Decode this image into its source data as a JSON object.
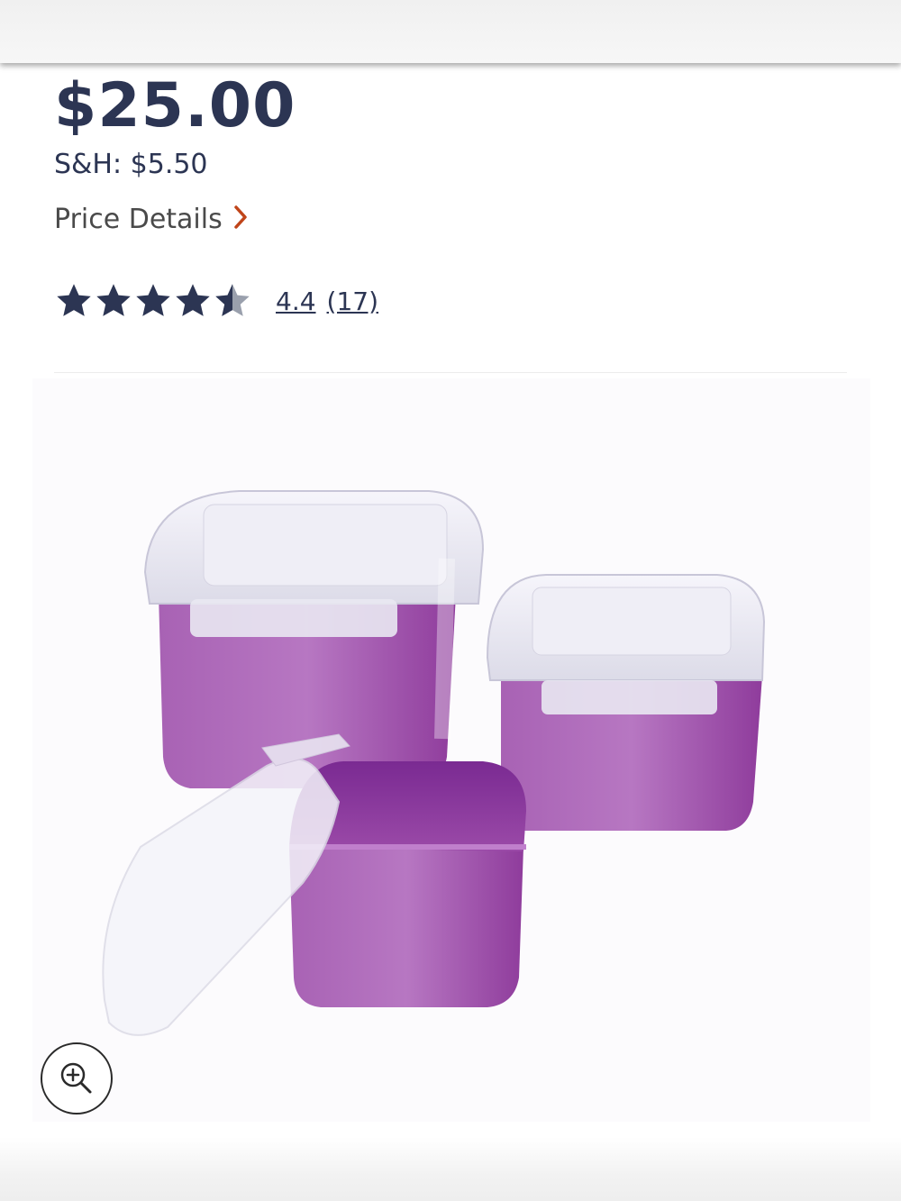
{
  "product": {
    "price": "$25.00",
    "shipping": "S&H: $5.50",
    "price_details_label": "Price Details",
    "rating": {
      "value": "4.4",
      "count": "(17)",
      "stars_fraction": 0.88
    },
    "image": {
      "subject": "purple food storage containers"
    }
  },
  "colors": {
    "price_text": "#2c3553",
    "chevron": "#c0451a",
    "container_purple": "#9b4aa8",
    "star_filled": "#2c3553",
    "star_empty": "#9aa0ad"
  },
  "icons": {
    "chevron": "chevron-right-icon",
    "zoom": "zoom-in-icon",
    "star": "star-icon"
  }
}
